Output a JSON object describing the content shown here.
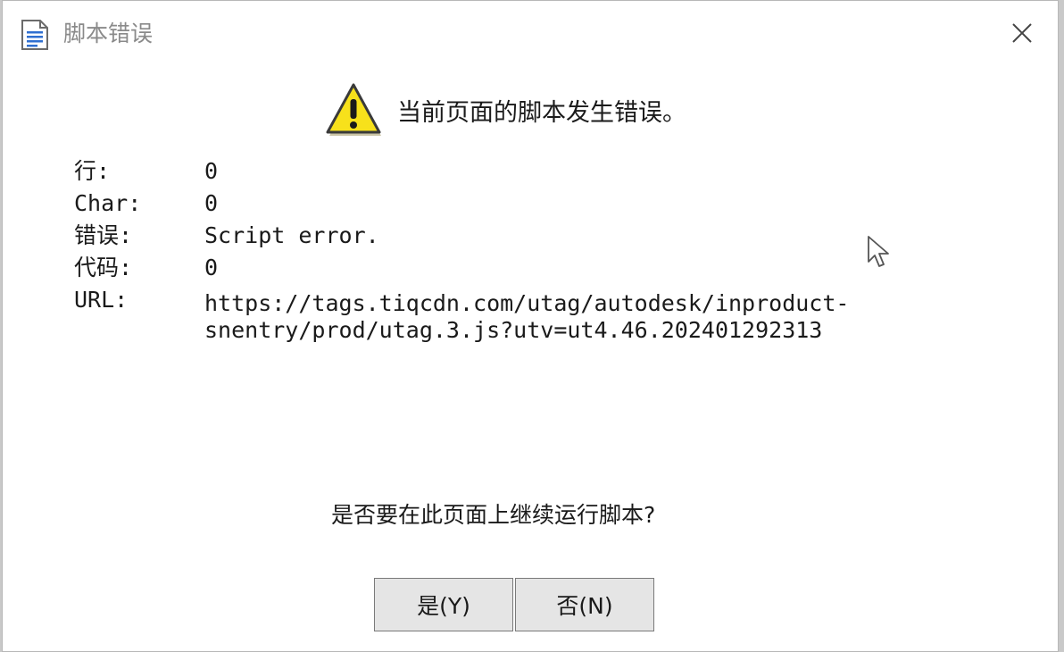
{
  "dialog": {
    "title": "脚本错误",
    "message": "当前页面的脚本发生错误。",
    "fields": [
      {
        "label": "行:",
        "value": "0"
      },
      {
        "label": "Char:",
        "value": "0"
      },
      {
        "label": "错误:",
        "value": "Script error."
      },
      {
        "label": "代码:",
        "value": "0"
      },
      {
        "label": "URL:",
        "value": "https://tags.tiqcdn.com/utag/autodesk/inproduct-\nsnentry/prod/utag.3.js?utv=ut4.46.202401292313"
      }
    ],
    "question": "是否要在此页面上继续运行脚本?",
    "yes_label": "是(Y)",
    "no_label": "否(N)"
  },
  "icons": {
    "title": "document-icon",
    "warning": "warning-icon",
    "close": "close-icon",
    "cursor": "mouse-cursor-icon"
  },
  "colors": {
    "warning_fill": "#f7e11b",
    "button_bg": "#e5e5e5",
    "button_border": "#7a7a7a",
    "title_text": "#8a8a8a"
  }
}
